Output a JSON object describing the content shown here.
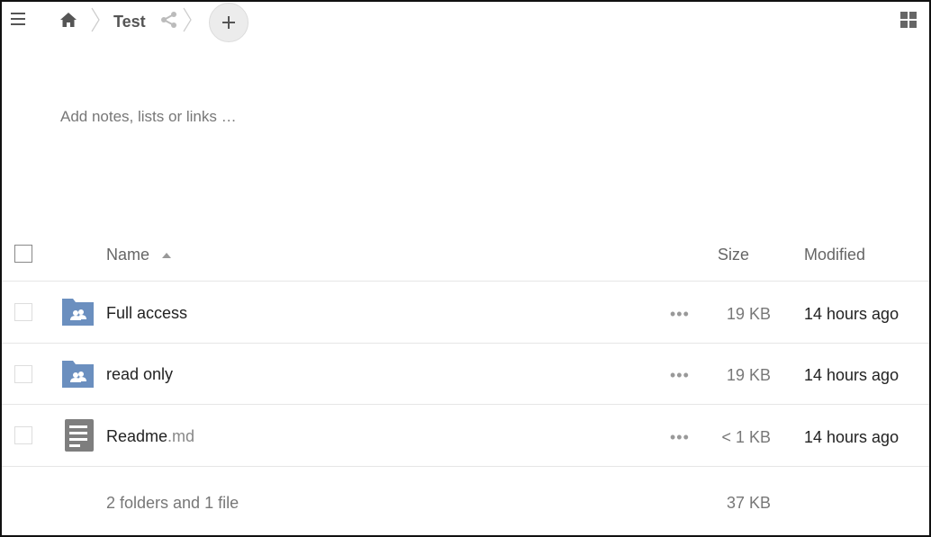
{
  "header": {
    "breadcrumb": "Test",
    "new_button": "+"
  },
  "notes": {
    "placeholder": "Add notes, lists or links …"
  },
  "table": {
    "columns": {
      "name": "Name",
      "size": "Size",
      "modified": "Modified"
    },
    "actions_glyph": "•••",
    "rows": [
      {
        "name": "Full access",
        "ext": "",
        "type": "shared-folder",
        "size": "19 KB",
        "modified": "14 hours ago"
      },
      {
        "name": "read only",
        "ext": "",
        "type": "shared-folder",
        "size": "19 KB",
        "modified": "14 hours ago"
      },
      {
        "name": "Readme",
        "ext": ".md",
        "type": "text-file",
        "size": "< 1 KB",
        "modified": "14 hours ago"
      }
    ],
    "summary": {
      "count": "2 folders and 1 file",
      "size": "37 KB"
    }
  },
  "colors": {
    "folder": "#6b8fbf",
    "file": "#7e7e7e",
    "divider": "#e6e6e6"
  }
}
